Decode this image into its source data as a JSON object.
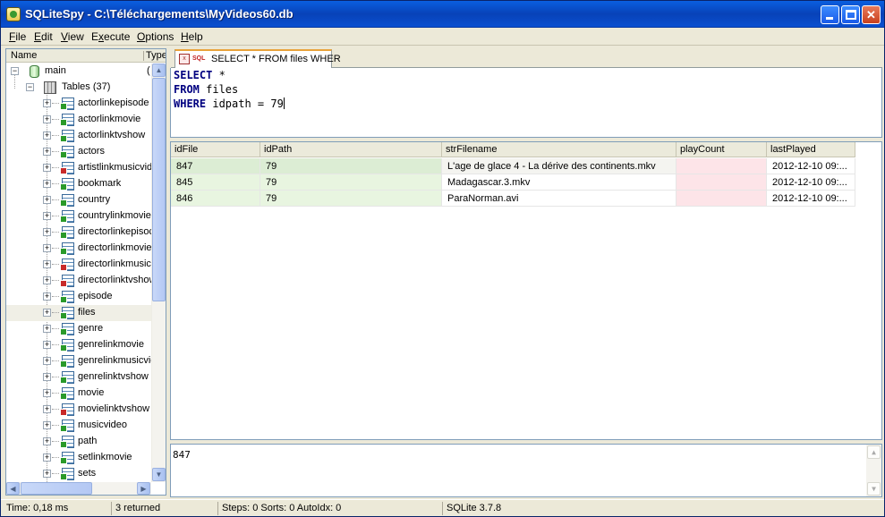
{
  "window": {
    "title": "SQLiteSpy - C:\\Téléchargements\\MyVideos60.db"
  },
  "menu": [
    {
      "label": "File",
      "underline": "F",
      "rest": "ile"
    },
    {
      "label": "Edit",
      "underline": "E",
      "rest": "dit"
    },
    {
      "label": "View",
      "underline": "V",
      "rest": "iew"
    },
    {
      "label": "Execute",
      "underline": "x",
      "pre": "E",
      "rest": "ecute"
    },
    {
      "label": "Options",
      "underline": "O",
      "rest": "ptions"
    },
    {
      "label": "Help",
      "underline": "H",
      "rest": "elp"
    }
  ],
  "tree": {
    "headers": {
      "name": "Name",
      "type": "Type"
    },
    "root": {
      "label": "main",
      "type_hint": "("
    },
    "tables_node": "Tables (37)",
    "items": [
      {
        "label": "actorlinkepisode",
        "kind": "plus"
      },
      {
        "label": "actorlinkmovie",
        "kind": "plus"
      },
      {
        "label": "actorlinktvshow",
        "kind": "plus"
      },
      {
        "label": "actors",
        "kind": "plus"
      },
      {
        "label": "artistlinkmusicvid",
        "kind": "minus"
      },
      {
        "label": "bookmark",
        "kind": "plus"
      },
      {
        "label": "country",
        "kind": "plus"
      },
      {
        "label": "countrylinkmovie",
        "kind": "plus"
      },
      {
        "label": "directorlinkepisoc",
        "kind": "plus"
      },
      {
        "label": "directorlinkmovie",
        "kind": "plus"
      },
      {
        "label": "directorlinkmusicv",
        "kind": "minus"
      },
      {
        "label": "directorlinktvshow",
        "kind": "minus"
      },
      {
        "label": "episode",
        "kind": "plus"
      },
      {
        "label": "files",
        "kind": "plus",
        "selected": true
      },
      {
        "label": "genre",
        "kind": "plus"
      },
      {
        "label": "genrelinkmovie",
        "kind": "plus"
      },
      {
        "label": "genrelinkmusicvic",
        "kind": "plus"
      },
      {
        "label": "genrelinktvshow",
        "kind": "plus"
      },
      {
        "label": "movie",
        "kind": "plus"
      },
      {
        "label": "movielinktvshow",
        "kind": "minus"
      },
      {
        "label": "musicvideo",
        "kind": "plus"
      },
      {
        "label": "path",
        "kind": "plus"
      },
      {
        "label": "setlinkmovie",
        "kind": "plus"
      },
      {
        "label": "sets",
        "kind": "plus"
      }
    ]
  },
  "tab": {
    "label": "SELECT * FROM files WHER",
    "icon_text": "SQL"
  },
  "editor": {
    "lines": [
      {
        "kw": "SELECT",
        "rest": " *"
      },
      {
        "kw": "FROM",
        "rest": " files"
      },
      {
        "kw": "WHERE",
        "rest": " idpath = 79"
      }
    ]
  },
  "grid": {
    "columns": [
      "idFile",
      "idPath",
      "strFilename",
      "playCount",
      "lastPlayed"
    ],
    "rows": [
      [
        "847",
        "79",
        "L'age de glace 4 - La dérive des continents.mkv",
        "",
        "2012-12-10 09:..."
      ],
      [
        "845",
        "79",
        "Madagascar.3.mkv",
        "",
        "2012-12-10 09:..."
      ],
      [
        "846",
        "79",
        "ParaNorman.avi",
        "",
        "2012-12-10 09:..."
      ]
    ],
    "colors": {
      "id": "#e8f5e0",
      "null": "#fde4e8",
      "selected": "#dcedd4"
    }
  },
  "value_panel": {
    "value": "847"
  },
  "status": {
    "time": "Time: 0,18 ms",
    "returned": "3 returned",
    "steps": "Steps: 0 Sorts: 0 AutoIdx: 0",
    "version": "SQLite 3.7.8"
  }
}
